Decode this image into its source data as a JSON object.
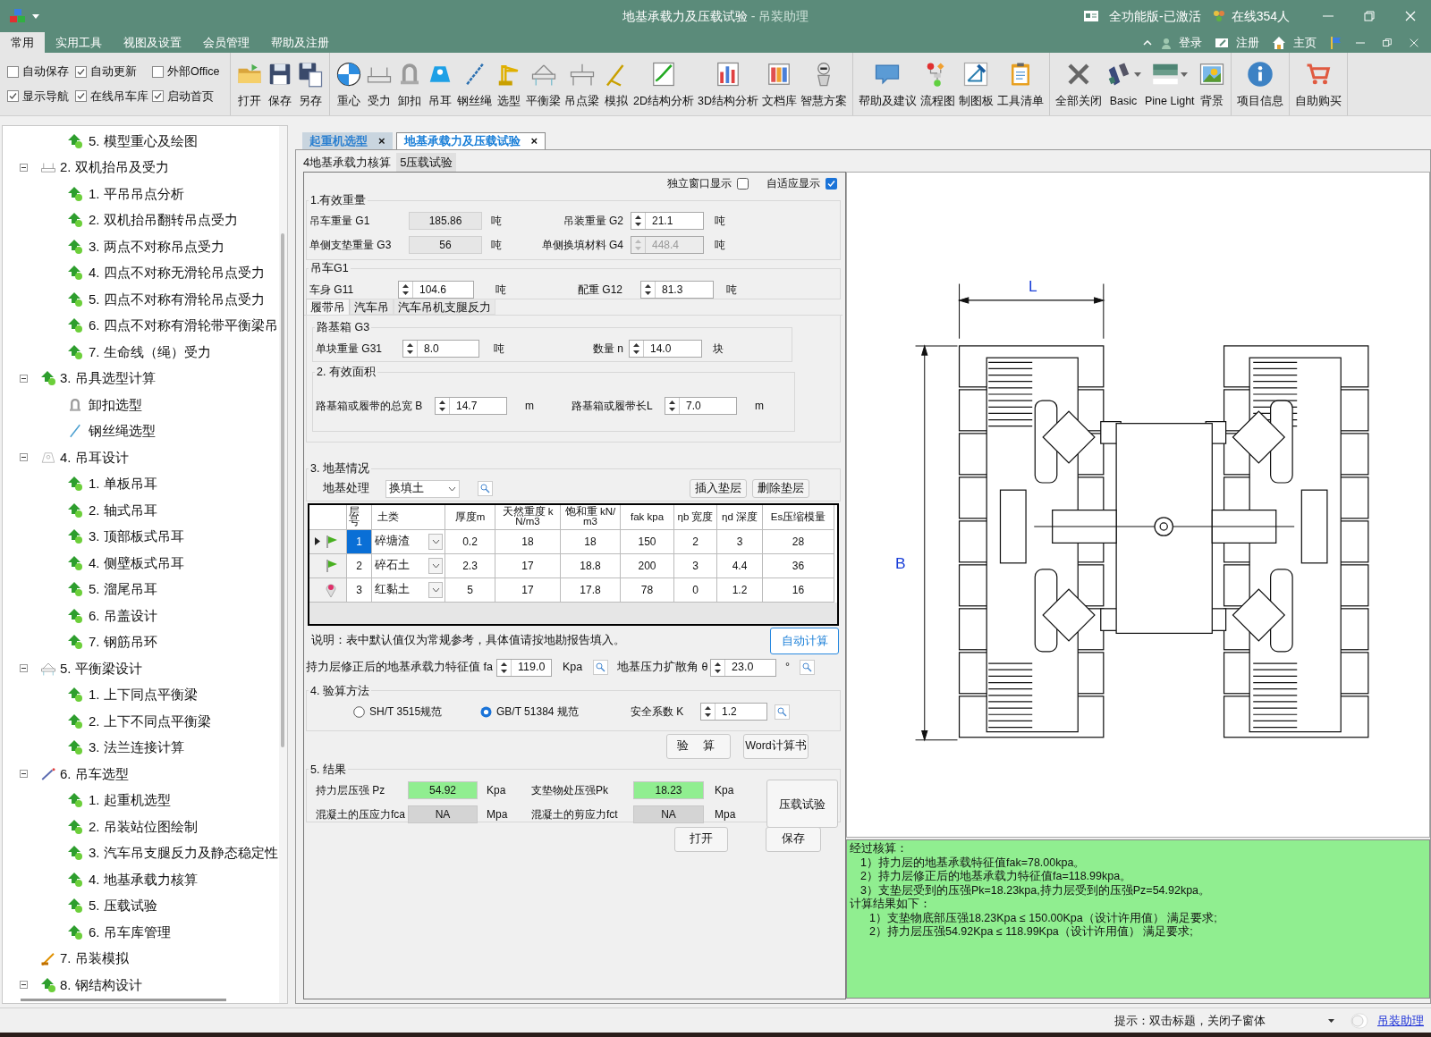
{
  "window": {
    "title": "地基承载力及压载试验",
    "app_name": "- 吊装助理",
    "license": "全功能版-已激活",
    "online": "在线354人"
  },
  "menu_tabs": [
    {
      "label": "常用",
      "selected": true
    },
    {
      "label": "实用工具",
      "selected": false
    },
    {
      "label": "视图及设置",
      "selected": false
    },
    {
      "label": "会员管理",
      "selected": false
    },
    {
      "label": "帮助及注册",
      "selected": false
    }
  ],
  "account_links": [
    "登录",
    "注册",
    "主页"
  ],
  "ribbon": {
    "options": [
      {
        "label": "自动保存",
        "checked": false
      },
      {
        "label": "自动更新",
        "checked": true
      },
      {
        "label": "外部Office",
        "checked": false
      },
      {
        "label": "显示导航",
        "checked": true
      },
      {
        "label": "在线吊车库",
        "checked": true
      },
      {
        "label": "启动首页",
        "checked": true
      }
    ],
    "groups": [
      [
        {
          "label": "打开"
        },
        {
          "label": "保存"
        },
        {
          "label": "另存"
        }
      ],
      [
        {
          "label": "重心"
        },
        {
          "label": "受力"
        },
        {
          "label": "卸扣"
        },
        {
          "label": "吊耳"
        },
        {
          "label": "钢丝绳"
        },
        {
          "label": "选型"
        },
        {
          "label": "平衡梁"
        },
        {
          "label": "吊点梁"
        },
        {
          "label": "模拟"
        },
        {
          "label": "2D结构分析"
        },
        {
          "label": "3D结构分析"
        },
        {
          "label": "文档库"
        },
        {
          "label": "智慧方案"
        }
      ],
      [
        {
          "label": "帮助及建议"
        },
        {
          "label": "流程图"
        },
        {
          "label": "制图板"
        },
        {
          "label": "工具清单"
        }
      ],
      [
        {
          "label": "全部关闭",
          "dropdown": false
        },
        {
          "label": "Basic",
          "dropdown": true
        },
        {
          "label": "Pine Light",
          "dropdown": true
        },
        {
          "label": "背景",
          "dropdown": false
        }
      ],
      [
        {
          "label": "项目信息"
        }
      ],
      [
        {
          "label": "自助购买"
        }
      ]
    ]
  },
  "sidebar": {
    "items": [
      {
        "children": [
          {
            "label": "5. 模型重心及绘图"
          }
        ]
      },
      {
        "label": "2. 双机抬吊及受力",
        "expanded": true,
        "children": [
          {
            "label": "1. 平吊吊点分析"
          },
          {
            "label": "2. 双机抬吊翻转吊点受力"
          },
          {
            "label": "3. 两点不对称吊点受力"
          },
          {
            "label": "4. 四点不对称无滑轮吊点受力"
          },
          {
            "label": "5. 四点不对称有滑轮吊点受力"
          },
          {
            "label": "6. 四点不对称有滑轮带平衡梁吊"
          },
          {
            "label": "7. 生命线（绳）受力"
          }
        ]
      },
      {
        "label": "3. 吊具选型计算",
        "expanded": true,
        "children": [
          {
            "label": "卸扣选型"
          },
          {
            "label": "钢丝绳选型"
          }
        ]
      },
      {
        "label": "4. 吊耳设计",
        "expanded": true,
        "children": [
          {
            "label": "1. 单板吊耳"
          },
          {
            "label": "2. 轴式吊耳"
          },
          {
            "label": "3. 顶部板式吊耳"
          },
          {
            "label": "4. 侧壁板式吊耳"
          },
          {
            "label": "5. 溜尾吊耳"
          },
          {
            "label": "6. 吊盖设计"
          },
          {
            "label": "7. 钢筋吊环"
          }
        ]
      },
      {
        "label": "5. 平衡梁设计",
        "expanded": true,
        "children": [
          {
            "label": "1. 上下同点平衡梁"
          },
          {
            "label": "2. 上下不同点平衡梁"
          },
          {
            "label": "3. 法兰连接计算"
          }
        ]
      },
      {
        "label": "6. 吊车选型",
        "expanded": true,
        "children": [
          {
            "label": "1. 起重机选型"
          },
          {
            "label": "2. 吊装站位图绘制"
          },
          {
            "label": "3. 汽车吊支腿反力及静态稳定性"
          },
          {
            "label": "4. 地基承载力核算"
          },
          {
            "label": "5. 压载试验"
          },
          {
            "label": "6. 吊车库管理"
          }
        ]
      },
      {
        "label": "7. 吊装模拟"
      },
      {
        "label": "8. 钢结构设计",
        "expanded": true
      }
    ]
  },
  "doc_tabs": [
    {
      "label": "起重机选型",
      "selected": false,
      "close": "×"
    },
    {
      "label": "地基承载力及压载试验",
      "selected": true,
      "close": "×"
    }
  ],
  "sub_tabs": [
    {
      "label": "4地基承载力核算",
      "selected": true
    },
    {
      "label": "5压载试验",
      "selected": false
    }
  ],
  "form": {
    "options": [
      {
        "label": "独立窗口显示",
        "checked": false
      },
      {
        "label": "自适应显示",
        "checked": true
      }
    ],
    "weight": {
      "title": "1.有效重量",
      "fields": [
        {
          "label": "吊车重量 G1",
          "kind": "readonly",
          "value": "185.86",
          "unit": "吨",
          "disabled": false
        },
        {
          "label": "吊装重量 G2",
          "kind": "spin",
          "value": "21.1",
          "unit": "吨",
          "disabled": false
        },
        {
          "label": "单侧支垫重量 G3",
          "kind": "readonly",
          "value": "56",
          "unit": "吨",
          "disabled": false
        },
        {
          "label": "单侧换填材料 G4",
          "kind": "spin",
          "value": "448.4",
          "unit": "吨",
          "disabled": true
        }
      ]
    },
    "crane": {
      "title": "吊车G1",
      "fields": [
        {
          "label": "车身 G11",
          "value": "104.6",
          "unit": "吨"
        },
        {
          "label": "配重 G12",
          "value": "81.3",
          "unit": "吨"
        }
      ]
    },
    "crane_tabs": [
      {
        "label": "履带吊",
        "selected": true
      },
      {
        "label": "汽车吊",
        "selected": false
      },
      {
        "label": "汽车吊机支腿反力",
        "selected": false
      }
    ],
    "mats": {
      "title": "路基箱 G3",
      "fields": [
        {
          "label": "单块重量 G31",
          "value": "8.0",
          "unit": "吨"
        },
        {
          "label": "数量 n",
          "value": "14.0",
          "unit": "块"
        }
      ]
    },
    "area": {
      "title": "2. 有效面积",
      "fields": [
        {
          "label": "路基箱或履带的总宽 B",
          "value": "14.7",
          "unit": "m"
        },
        {
          "label": "路基箱或履带长L",
          "value": "7.0",
          "unit": "m"
        }
      ]
    },
    "ground": {
      "title": "3. 地基情况",
      "treatment_label": "地基处理",
      "treatment": "换填土",
      "buttons": [
        "插入垫层",
        "删除垫层"
      ],
      "table": {
        "columns": [
          "层号",
          "土类",
          "厚度m",
          "天然重度 kN/m3",
          "饱和重 kN/m3",
          "fak kpa",
          "ηb 宽度",
          "ηd 深度",
          "Es压缩模量"
        ],
        "rows": [
          {
            "kind": "flag",
            "current": true,
            "selected": true,
            "layer": "1",
            "soil": "碎塘渣",
            "values": [
              "0.2",
              "18",
              "18",
              "150",
              "2",
              "3",
              "28"
            ]
          },
          {
            "kind": "flag",
            "current": false,
            "selected": false,
            "layer": "2",
            "soil": "碎石土",
            "values": [
              "2.3",
              "17",
              "18.8",
              "200",
              "3",
              "4.4",
              "36"
            ]
          },
          {
            "kind": "pin",
            "current": false,
            "selected": false,
            "layer": "3",
            "soil": "红黏土",
            "values": [
              "5",
              "17",
              "17.8",
              "78",
              "0",
              "1.2",
              "16"
            ]
          }
        ]
      }
    },
    "note": "说明：表中默认值仅为常规参考，具体值请按地勘报告填入。",
    "auto_button": "自动计算",
    "params": [
      {
        "label": "持力层修正后的地基承载力特征值 fa",
        "value": "119.0",
        "unit": "Kpa"
      },
      {
        "label": "地基压力扩散角 θ",
        "value": "23.0",
        "unit": "°"
      }
    ],
    "method": {
      "title": "4. 验算方法",
      "options": [
        {
          "label": "SH/T 3515规范",
          "selected": false
        },
        {
          "label": "GB/T 51384 规范",
          "selected": true
        }
      ],
      "factor": {
        "label": "安全系数 K",
        "value": "1.2"
      }
    },
    "actions": [
      "验 算",
      "Word计算书"
    ],
    "results": {
      "title": "5. 结果",
      "fields": [
        {
          "label": "持力层压强 Pz",
          "value": "54.92",
          "unit": "Kpa",
          "color": "#90ee90"
        },
        {
          "label": "支垫物处压强Pk",
          "value": "18.23",
          "unit": "Kpa",
          "color": "#90ee90"
        },
        {
          "label": "混凝土的压应力fca",
          "value": "NA",
          "unit": "Mpa",
          "color": "#d4d4d4"
        },
        {
          "label": "混凝土的剪应力fct",
          "value": "NA",
          "unit": "Mpa",
          "color": "#d4d4d4"
        }
      ],
      "button": "压载试验"
    },
    "file_buttons": [
      "打开",
      "保存"
    ]
  },
  "drawing": {
    "width_label": "L",
    "length_label": "B"
  },
  "report": [
    {
      "text": "经过核算：",
      "children": [
        {
          "text": "1）持力层的地基承载特征值fak=78.00kpa。"
        },
        {
          "text": "2）持力层修正后的地基承载力特征值fa=118.99kpa。"
        },
        {
          "text": "3）支垫层受到的压强Pk=18.23kpa,持力层受到的压强Pz=54.92kpa。"
        }
      ]
    },
    {
      "text": "计算结果如下：",
      "children": [
        {
          "text": "1）支垫物底部压强18.23Kpa ≤ 150.00Kpa（设计许用值） 满足要求;"
        },
        {
          "text": "2）持力层压强54.92Kpa ≤ 118.99Kpa（设计许用值） 满足要求;"
        }
      ]
    }
  ],
  "status_bar": {
    "hint": "提示：双击标题，关闭子窗体",
    "link": "吊装助理"
  }
}
